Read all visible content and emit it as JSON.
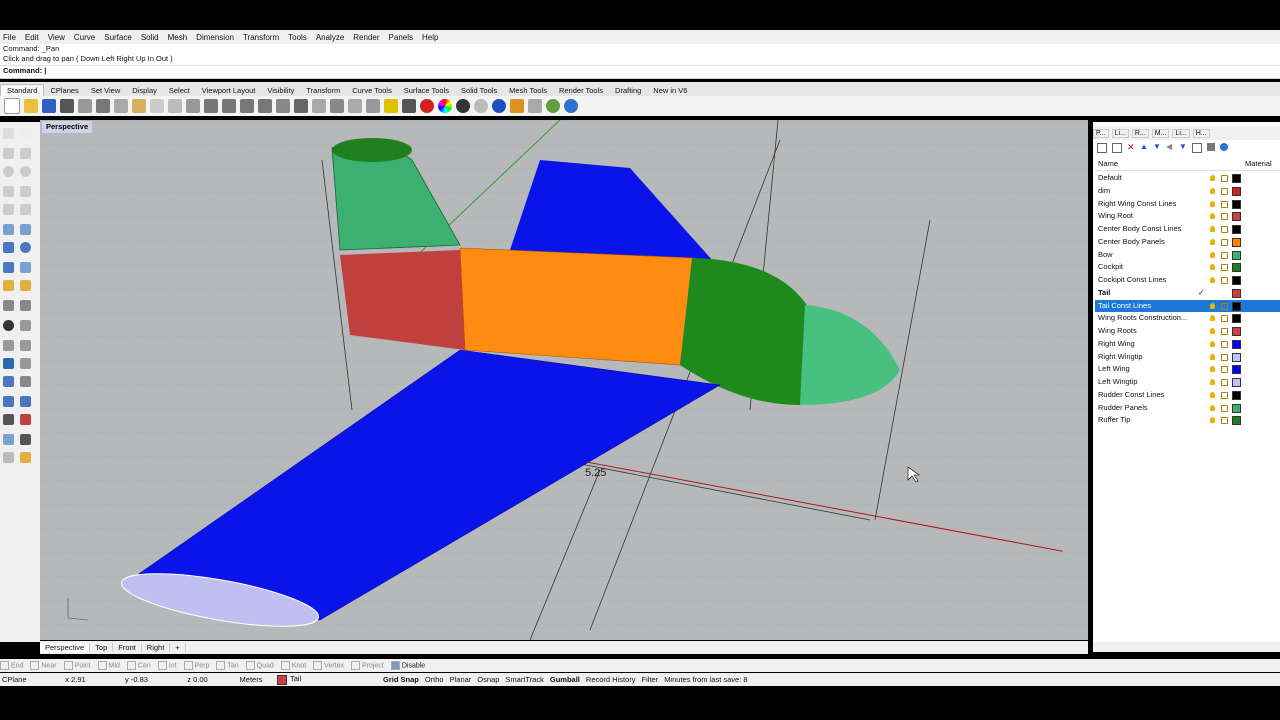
{
  "menu": [
    "File",
    "Edit",
    "View",
    "Curve",
    "Surface",
    "Solid",
    "Mesh",
    "Dimension",
    "Transform",
    "Tools",
    "Analyze",
    "Render",
    "Panels",
    "Help"
  ],
  "command": {
    "line1": "Command: _Pan",
    "line2": "Click and drag to pan ( Down  Left  Right  Up  In  Out )",
    "prompt": "Command:"
  },
  "tabs": [
    "Standard",
    "CPlanes",
    "Set View",
    "Display",
    "Select",
    "Viewport Layout",
    "Visibility",
    "Transform",
    "Curve Tools",
    "Surface Tools",
    "Solid Tools",
    "Mesh Tools",
    "Render Tools",
    "Drafting",
    "New in V6"
  ],
  "viewport": {
    "label": "Perspective",
    "dimension_text": "5.25",
    "tabs": [
      "Perspective",
      "Top",
      "Front",
      "Right"
    ]
  },
  "panel": {
    "tabs": [
      "P...",
      "Li...",
      "R...",
      "M...",
      "Li...",
      "H..."
    ],
    "col_name": "Name",
    "col_material": "Material",
    "layers": [
      {
        "name": "Default",
        "color": "#000000"
      },
      {
        "name": "dim",
        "color": "#cc2222"
      },
      {
        "name": "Right Wing Const Lines",
        "color": "#000000"
      },
      {
        "name": "Wing Root",
        "color": "#c84040"
      },
      {
        "name": "Center Body Const Lines",
        "color": "#000000"
      },
      {
        "name": "Center Body Panels",
        "color": "#ff8000"
      },
      {
        "name": "Bow",
        "color": "#40b070"
      },
      {
        "name": "Cockpit",
        "color": "#208020"
      },
      {
        "name": "Cockipit Const Lines",
        "color": "#000000"
      },
      {
        "name": "Tail",
        "color": "#c84040",
        "current": true
      },
      {
        "name": "Tail Const Lines",
        "color": "#000000",
        "selected": true
      },
      {
        "name": "Wing Roots Construction...",
        "color": "#000000"
      },
      {
        "name": "Wing Roots",
        "color": "#c84040"
      },
      {
        "name": "Right Wing",
        "color": "#0000ff"
      },
      {
        "name": "Right Wingtip",
        "color": "#c0c0ff"
      },
      {
        "name": "Left Wing",
        "color": "#0000ff"
      },
      {
        "name": "Left Wingtip",
        "color": "#c0c0ff"
      },
      {
        "name": "Rudder Const Lines",
        "color": "#000000"
      },
      {
        "name": "Rudder Panels",
        "color": "#40b070"
      },
      {
        "name": "Ruffer Tip",
        "color": "#208020"
      }
    ]
  },
  "osnaps": [
    "End",
    "Near",
    "Point",
    "Mid",
    "Cen",
    "Int",
    "Perp",
    "Tan",
    "Quad",
    "Knot",
    "Vertex",
    "Project",
    "Disable"
  ],
  "status": {
    "cplane": "CPlane",
    "x": "x 2.91",
    "y": "y -0.83",
    "z": "z 0.00",
    "units": "Meters",
    "layer": "Tail",
    "layer_color": "#c84040",
    "items": [
      "Grid Snap",
      "Ortho",
      "Planar",
      "Osnap",
      "SmartTrack",
      "Gumball",
      "Record History",
      "Filter"
    ],
    "save": "Minutes from last save: 8"
  }
}
